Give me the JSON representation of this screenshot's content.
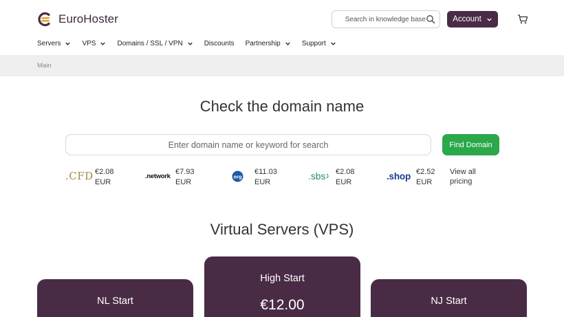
{
  "brand": {
    "name": "EuroHoster"
  },
  "search": {
    "placeholder": "Search in knowledge base"
  },
  "account": {
    "label": "Account"
  },
  "nav": [
    {
      "label": "Servers",
      "dropdown": true
    },
    {
      "label": "VPS",
      "dropdown": true
    },
    {
      "label": "Domains / SSL / VPN",
      "dropdown": true
    },
    {
      "label": "Discounts",
      "dropdown": false
    },
    {
      "label": "Partnership",
      "dropdown": true
    },
    {
      "label": "Support",
      "dropdown": true
    }
  ],
  "breadcrumb": {
    "current": "Main"
  },
  "domain": {
    "title": "Check the domain name",
    "placeholder": "Enter domain name or keyword for search",
    "button": "Find Domain",
    "view_all": "View all pricing",
    "tlds": [
      {
        "name": ".CFD",
        "price": "€2.08",
        "currency": "EUR"
      },
      {
        "name": ".network",
        "price": "€7.93",
        "currency": "EUR"
      },
      {
        "name": ".org",
        "price": "€11.03",
        "currency": "EUR"
      },
      {
        "name": ".sbs",
        "price": "€2.08",
        "currency": "EUR"
      },
      {
        "name": ".shop",
        "price": "€2.52",
        "currency": "EUR"
      }
    ]
  },
  "vps": {
    "title": "Virtual Servers (VPS)",
    "plans": [
      {
        "name": "NL Start"
      },
      {
        "name": "High Start",
        "price": "€12.00"
      },
      {
        "name": "NJ Start"
      }
    ]
  },
  "colors": {
    "brand_purple": "#4a2b45",
    "accent_green": "#2aa84a",
    "logo_orange": "#e8a23a"
  }
}
